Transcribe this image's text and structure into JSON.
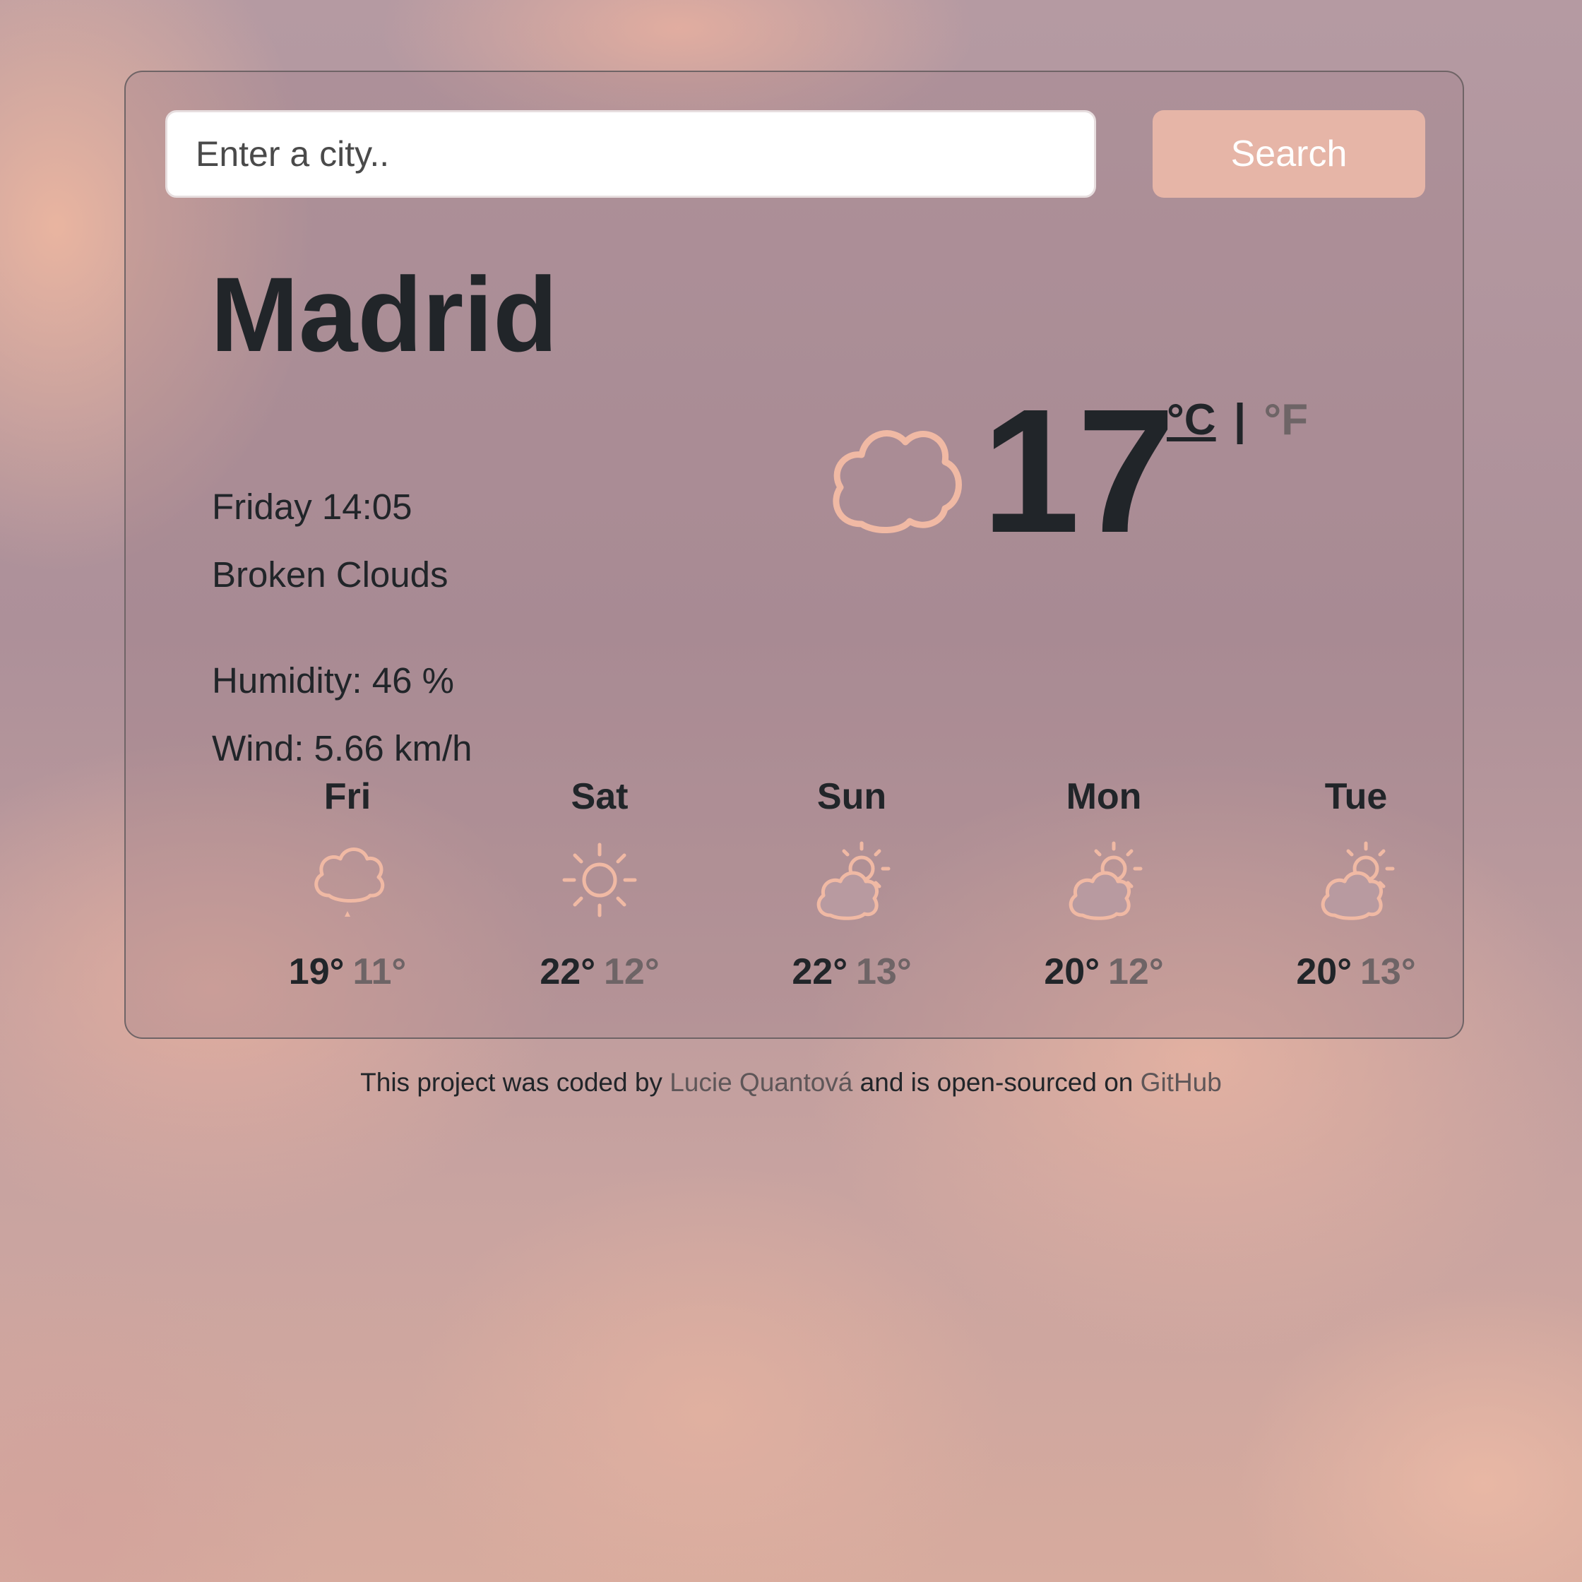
{
  "search": {
    "placeholder": "Enter a city..",
    "button_label": "Search"
  },
  "current": {
    "city": "Madrid",
    "datetime": "Friday 14:05",
    "description": "Broken Clouds",
    "humidity": "Humidity: 46 %",
    "wind": "Wind: 5.66 km/h",
    "temperature": "17",
    "icon": "cloud-icon",
    "unit_celsius": "°C",
    "unit_separator": "|",
    "unit_fahrenheit": "°F"
  },
  "forecast": [
    {
      "day": "Fri",
      "icon": "cloud-rain-icon",
      "max": "19°",
      "min": "11°"
    },
    {
      "day": "Sat",
      "icon": "sun-icon",
      "max": "22°",
      "min": "12°"
    },
    {
      "day": "Sun",
      "icon": "partly-cloudy-icon",
      "max": "22°",
      "min": "13°"
    },
    {
      "day": "Mon",
      "icon": "partly-cloudy-icon",
      "max": "20°",
      "min": "12°"
    },
    {
      "day": "Tue",
      "icon": "partly-cloudy-icon",
      "max": "20°",
      "min": "13°"
    }
  ],
  "footer": {
    "text_1": "This project was coded by",
    "author": "Lucie Quantová",
    "text_2": "and is open-sourced on",
    "repo_link": "GitHub"
  },
  "colors": {
    "accent": "#e6b5a7",
    "icon": "#f0b9a4",
    "text": "#212529",
    "muted": "#6e6466"
  }
}
